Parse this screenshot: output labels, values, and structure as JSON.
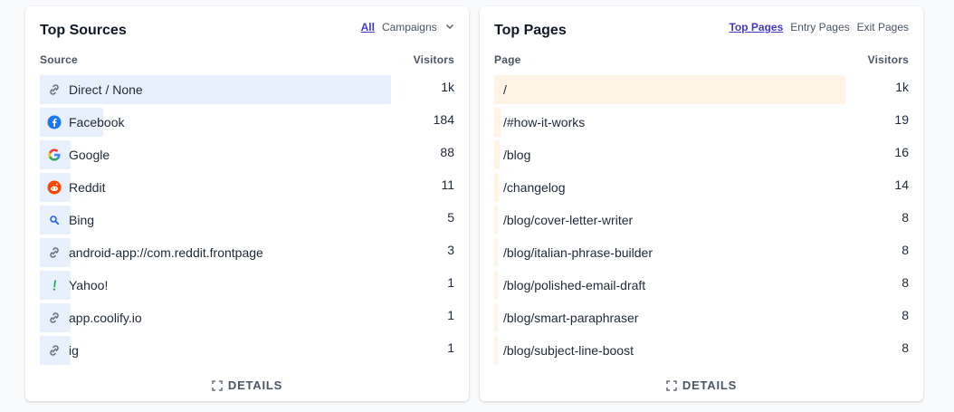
{
  "sources": {
    "title": "Top Sources",
    "tabs": [
      {
        "label": "All",
        "active": true
      },
      {
        "label": "Campaigns",
        "active": false
      }
    ],
    "column_left": "Source",
    "column_right": "Visitors",
    "rows": [
      {
        "label": "Direct / None",
        "value": "1k",
        "icon": "link-icon",
        "fraction": 1.0
      },
      {
        "label": "Facebook",
        "value": "184",
        "icon": "facebook-icon",
        "fraction": 0.18
      },
      {
        "label": "Google",
        "value": "88",
        "icon": "google-icon",
        "fraction": 0.088
      },
      {
        "label": "Reddit",
        "value": "11",
        "icon": "reddit-icon",
        "fraction": 0.011
      },
      {
        "label": "Bing",
        "value": "5",
        "icon": "bing-icon",
        "fraction": 0.005
      },
      {
        "label": "android-app://com.reddit.frontpage",
        "value": "3",
        "icon": "link-icon",
        "fraction": 0.003
      },
      {
        "label": "Yahoo!",
        "value": "1",
        "icon": "yahoo-icon",
        "fraction": 0.001
      },
      {
        "label": "app.coolify.io",
        "value": "1",
        "icon": "link-icon",
        "fraction": 0.001
      },
      {
        "label": "ig",
        "value": "1",
        "icon": "link-icon",
        "fraction": 0.001
      }
    ],
    "details_label": "DETAILS"
  },
  "pages": {
    "title": "Top Pages",
    "tabs": [
      {
        "label": "Top Pages",
        "active": true
      },
      {
        "label": "Entry Pages",
        "active": false
      },
      {
        "label": "Exit Pages",
        "active": false
      }
    ],
    "column_left": "Page",
    "column_right": "Visitors",
    "rows": [
      {
        "label": "/",
        "value": "1k",
        "fraction": 1.0
      },
      {
        "label": "/#how-it-works",
        "value": "19",
        "fraction": 0.019
      },
      {
        "label": "/blog",
        "value": "16",
        "fraction": 0.016
      },
      {
        "label": "/changelog",
        "value": "14",
        "fraction": 0.014
      },
      {
        "label": "/blog/cover-letter-writer",
        "value": "8",
        "fraction": 0.008
      },
      {
        "label": "/blog/italian-phrase-builder",
        "value": "8",
        "fraction": 0.008
      },
      {
        "label": "/blog/polished-email-draft",
        "value": "8",
        "fraction": 0.008
      },
      {
        "label": "/blog/smart-paraphraser",
        "value": "8",
        "fraction": 0.008
      },
      {
        "label": "/blog/subject-line-boost",
        "value": "8",
        "fraction": 0.008
      }
    ],
    "details_label": "DETAILS"
  },
  "colors": {
    "accent": "#4338ca",
    "sources_bar": "#e8f0fe",
    "pages_bar": "#fff4e6"
  }
}
